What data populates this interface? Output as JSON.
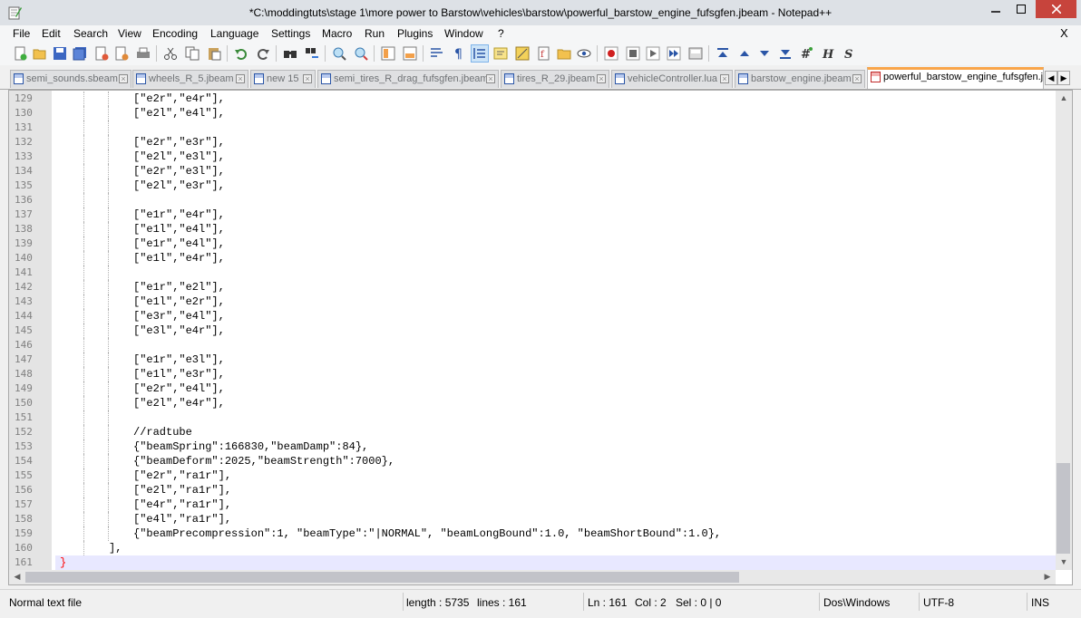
{
  "window": {
    "title": "*C:\\moddingtuts\\stage 1\\more power to Barstow\\vehicles\\barstow\\powerful_barstow_engine_fufsgfen.jbeam - Notepad++"
  },
  "menu": [
    "File",
    "Edit",
    "Search",
    "View",
    "Encoding",
    "Language",
    "Settings",
    "Macro",
    "Run",
    "Plugins",
    "Window",
    "?"
  ],
  "menu_close": "X",
  "toolbar_icons": [
    "new-file-icon",
    "open-file-icon",
    "save-icon",
    "save-all-icon",
    "close-icon",
    "close-all-icon",
    "print-icon",
    "cut-icon",
    "copy-icon",
    "paste-icon",
    "undo-icon",
    "redo-icon",
    "find-icon",
    "replace-icon",
    "zoom-in-icon",
    "zoom-out-icon",
    "sync-vertical-icon",
    "sync-horizontal-icon",
    "word-wrap-icon",
    "show-all-chars-icon",
    "indent-guide-icon",
    "doc-map-icon",
    "function-list-icon",
    "folder-workspace-icon",
    "monitoring-icon",
    "eye-icon",
    "record-macro-icon",
    "stop-macro-icon",
    "play-macro-icon",
    "run-macro-multiple-icon",
    "save-macro-icon",
    "up-first-icon",
    "up-icon",
    "down-icon",
    "down-last-icon",
    "plugin-hash-icon",
    "plugin-h-icon",
    "plugin-s-icon"
  ],
  "tabs": [
    {
      "label": "semi_sounds.sbeam"
    },
    {
      "label": "wheels_R_5.jbeam"
    },
    {
      "label": "new 15"
    },
    {
      "label": "semi_tires_R_drag_fufsgfen.jbeam"
    },
    {
      "label": "tires_R_29.jbeam"
    },
    {
      "label": "vehicleController.lua"
    },
    {
      "label": "barstow_engine.jbeam"
    },
    {
      "label": "powerful_barstow_engine_fufsgfen.jb"
    }
  ],
  "tab_arrows": {
    "left": "◀",
    "right": "▶"
  },
  "editor": {
    "lines": [
      {
        "num": "129",
        "text": "[\"e2r\",\"e4r\"],",
        "indent": 3
      },
      {
        "num": "130",
        "text": "[\"e2l\",\"e4l\"],",
        "indent": 3
      },
      {
        "num": "131",
        "text": "",
        "indent": 3
      },
      {
        "num": "132",
        "text": "[\"e2r\",\"e3r\"],",
        "indent": 3
      },
      {
        "num": "133",
        "text": "[\"e2l\",\"e3l\"],",
        "indent": 3
      },
      {
        "num": "134",
        "text": "[\"e2r\",\"e3l\"],",
        "indent": 3
      },
      {
        "num": "135",
        "text": "[\"e2l\",\"e3r\"],",
        "indent": 3
      },
      {
        "num": "136",
        "text": "",
        "indent": 3
      },
      {
        "num": "137",
        "text": "[\"e1r\",\"e4r\"],",
        "indent": 3
      },
      {
        "num": "138",
        "text": "[\"e1l\",\"e4l\"],",
        "indent": 3
      },
      {
        "num": "139",
        "text": "[\"e1r\",\"e4l\"],",
        "indent": 3
      },
      {
        "num": "140",
        "text": "[\"e1l\",\"e4r\"],",
        "indent": 3
      },
      {
        "num": "141",
        "text": "",
        "indent": 3
      },
      {
        "num": "142",
        "text": "[\"e1r\",\"e2l\"],",
        "indent": 3
      },
      {
        "num": "143",
        "text": "[\"e1l\",\"e2r\"],",
        "indent": 3
      },
      {
        "num": "144",
        "text": "[\"e3r\",\"e4l\"],",
        "indent": 3
      },
      {
        "num": "145",
        "text": "[\"e3l\",\"e4r\"],",
        "indent": 3
      },
      {
        "num": "146",
        "text": "",
        "indent": 3
      },
      {
        "num": "147",
        "text": "[\"e1r\",\"e3l\"],",
        "indent": 3
      },
      {
        "num": "148",
        "text": "[\"e1l\",\"e3r\"],",
        "indent": 3
      },
      {
        "num": "149",
        "text": "[\"e2r\",\"e4l\"],",
        "indent": 3
      },
      {
        "num": "150",
        "text": "[\"e2l\",\"e4r\"],",
        "indent": 3
      },
      {
        "num": "151",
        "text": "",
        "indent": 3
      },
      {
        "num": "152",
        "text": "//radtube",
        "indent": 3
      },
      {
        "num": "153",
        "text": "{\"beamSpring\":166830,\"beamDamp\":84},",
        "indent": 3
      },
      {
        "num": "154",
        "text": "{\"beamDeform\":2025,\"beamStrength\":7000},",
        "indent": 3
      },
      {
        "num": "155",
        "text": "[\"e2r\",\"ra1r\"],",
        "indent": 3
      },
      {
        "num": "156",
        "text": "[\"e2l\",\"ra1r\"],",
        "indent": 3
      },
      {
        "num": "157",
        "text": "[\"e4r\",\"ra1r\"],",
        "indent": 3
      },
      {
        "num": "158",
        "text": "[\"e4l\",\"ra1r\"],",
        "indent": 3
      },
      {
        "num": "159",
        "text": "{\"beamPrecompression\":1, \"beamType\":\"|NORMAL\", \"beamLongBound\":1.0, \"beamShortBound\":1.0},",
        "indent": 3
      },
      {
        "num": "160",
        "text": "],",
        "indent": 2
      },
      {
        "num": "161",
        "text": "}",
        "indent": 0
      }
    ]
  },
  "status": {
    "file_type": "Normal text file",
    "length": "length : 5735",
    "lines": "lines : 161",
    "ln": "Ln : 161",
    "col": "Col : 2",
    "sel": "Sel : 0 | 0",
    "eol": "Dos\\Windows",
    "encoding": "UTF-8",
    "mode": "INS"
  }
}
